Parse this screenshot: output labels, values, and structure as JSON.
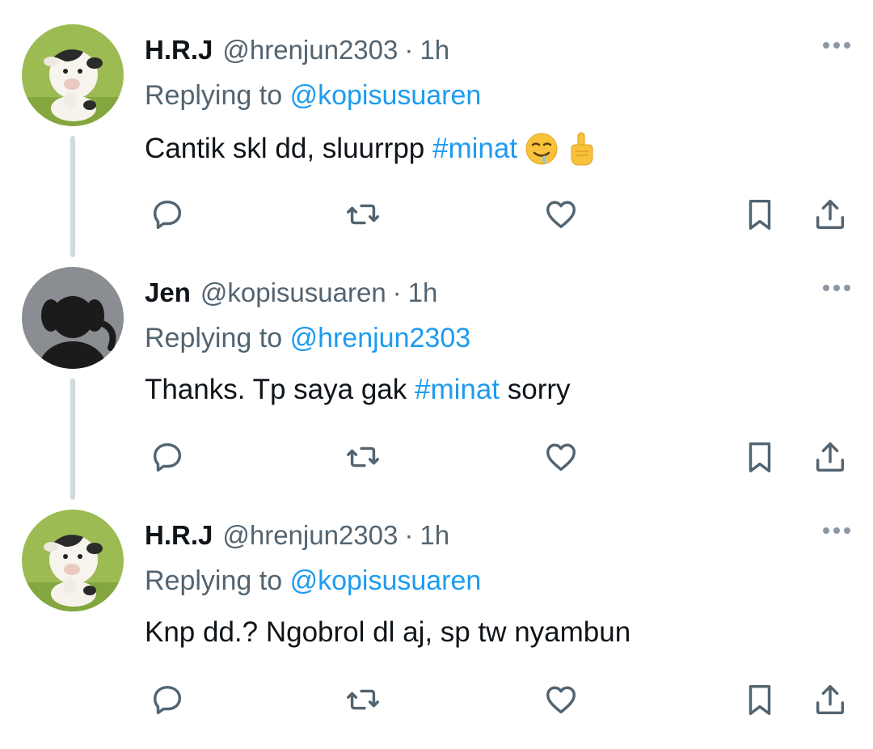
{
  "tweets": [
    {
      "display_name": "H.R.J",
      "handle": "@hrenjun2303",
      "separator": "·",
      "time": "1h",
      "replying_prefix": "Replying to",
      "replying_to": "@kopisusuaren",
      "text_before": "Cantik skl dd, sluurrpp ",
      "hashtag": "#minat",
      "text_after": "",
      "emojis": [
        "drooling-face-emoji",
        "index-pointing-up-emoji"
      ],
      "avatar": "cow-figurine-avatar",
      "thread_line": true
    },
    {
      "display_name": "Jen",
      "handle": "@kopisusuaren",
      "separator": "·",
      "time": "1h",
      "replying_prefix": "Replying to",
      "replying_to": "@hrenjun2303",
      "text_before": "Thanks. Tp saya gak ",
      "hashtag": "#minat",
      "text_after": " sorry",
      "emojis": [],
      "avatar": "default-dog-avatar",
      "thread_line": true
    },
    {
      "display_name": "H.R.J",
      "handle": "@hrenjun2303",
      "separator": "·",
      "time": "1h",
      "replying_prefix": "Replying to",
      "replying_to": "@kopisusuaren",
      "text_before": "Knp dd.? Ngobrol dl aj, sp tw nyambun",
      "hashtag": "",
      "text_after": "",
      "emojis": [],
      "avatar": "cow-figurine-avatar",
      "thread_line": false
    }
  ],
  "icons": {
    "reply": "reply-icon",
    "retweet": "retweet-icon",
    "like": "heart-icon",
    "bookmark": "bookmark-icon",
    "share": "share-icon",
    "more": "more-icon"
  },
  "colors": {
    "text": "#0f1419",
    "secondary": "#536471",
    "link": "#1d9bf0",
    "thread_line": "#cfd9de",
    "icon": "#536471"
  }
}
